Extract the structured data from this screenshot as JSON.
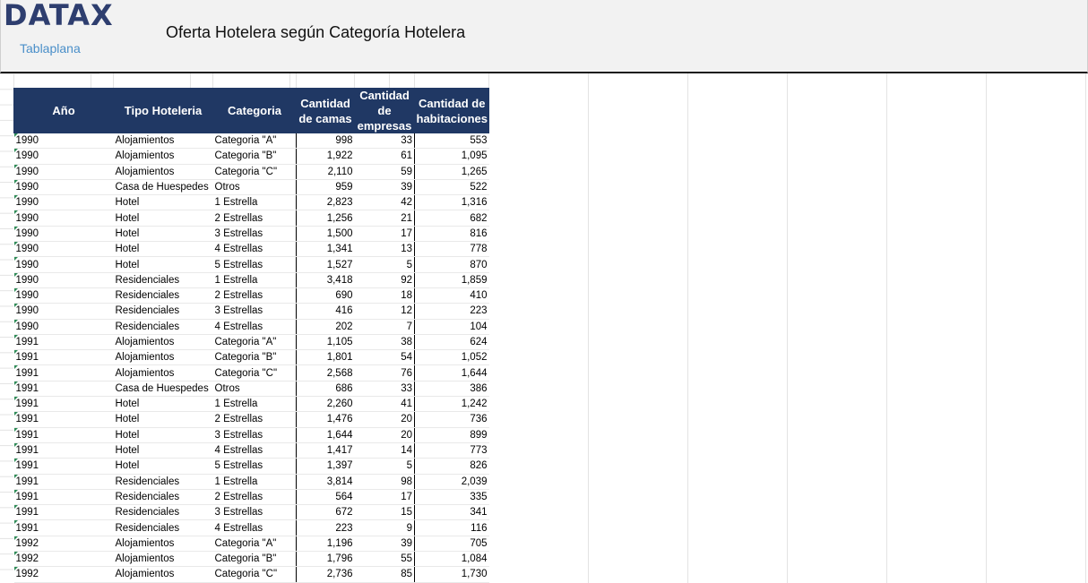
{
  "header": {
    "logo": "DATAX",
    "subtitle": "Tablaplana",
    "title": "Oferta Hotelera según Categoría Hotelera"
  },
  "table": {
    "columns": [
      "Año",
      "Tipo Hoteleria",
      "Categoria",
      "Cantidad de camas",
      "Cantidad de empresas",
      "Cantidad de habitaciones"
    ],
    "rows": [
      [
        "1990",
        "Alojamientos",
        "Categoria \"A\"",
        "998",
        "33",
        "553"
      ],
      [
        "1990",
        "Alojamientos",
        "Categoria \"B\"",
        "1,922",
        "61",
        "1,095"
      ],
      [
        "1990",
        "Alojamientos",
        "Categoria \"C\"",
        "2,110",
        "59",
        "1,265"
      ],
      [
        "1990",
        "Casa de Huespedes",
        "Otros",
        "959",
        "39",
        "522"
      ],
      [
        "1990",
        "Hotel",
        "1 Estrella",
        "2,823",
        "42",
        "1,316"
      ],
      [
        "1990",
        "Hotel",
        "2 Estrellas",
        "1,256",
        "21",
        "682"
      ],
      [
        "1990",
        "Hotel",
        "3 Estrellas",
        "1,500",
        "17",
        "816"
      ],
      [
        "1990",
        "Hotel",
        "4 Estrellas",
        "1,341",
        "13",
        "778"
      ],
      [
        "1990",
        "Hotel",
        "5 Estrellas",
        "1,527",
        "5",
        "870"
      ],
      [
        "1990",
        "Residenciales",
        "1 Estrella",
        "3,418",
        "92",
        "1,859"
      ],
      [
        "1990",
        "Residenciales",
        "2 Estrellas",
        "690",
        "18",
        "410"
      ],
      [
        "1990",
        "Residenciales",
        "3 Estrellas",
        "416",
        "12",
        "223"
      ],
      [
        "1990",
        "Residenciales",
        "4 Estrellas",
        "202",
        "7",
        "104"
      ],
      [
        "1991",
        "Alojamientos",
        "Categoria \"A\"",
        "1,105",
        "38",
        "624"
      ],
      [
        "1991",
        "Alojamientos",
        "Categoria \"B\"",
        "1,801",
        "54",
        "1,052"
      ],
      [
        "1991",
        "Alojamientos",
        "Categoria \"C\"",
        "2,568",
        "76",
        "1,644"
      ],
      [
        "1991",
        "Casa de Huespedes",
        "Otros",
        "686",
        "33",
        "386"
      ],
      [
        "1991",
        "Hotel",
        "1 Estrella",
        "2,260",
        "41",
        "1,242"
      ],
      [
        "1991",
        "Hotel",
        "2 Estrellas",
        "1,476",
        "20",
        "736"
      ],
      [
        "1991",
        "Hotel",
        "3 Estrellas",
        "1,644",
        "20",
        "899"
      ],
      [
        "1991",
        "Hotel",
        "4 Estrellas",
        "1,417",
        "14",
        "773"
      ],
      [
        "1991",
        "Hotel",
        "5 Estrellas",
        "1,397",
        "5",
        "826"
      ],
      [
        "1991",
        "Residenciales",
        "1 Estrella",
        "3,814",
        "98",
        "2,039"
      ],
      [
        "1991",
        "Residenciales",
        "2 Estrellas",
        "564",
        "17",
        "335"
      ],
      [
        "1991",
        "Residenciales",
        "3 Estrellas",
        "672",
        "15",
        "341"
      ],
      [
        "1991",
        "Residenciales",
        "4 Estrellas",
        "223",
        "9",
        "116"
      ],
      [
        "1992",
        "Alojamientos",
        "Categoria \"A\"",
        "1,196",
        "39",
        "705"
      ],
      [
        "1992",
        "Alojamientos",
        "Categoria \"B\"",
        "1,796",
        "55",
        "1,084"
      ],
      [
        "1992",
        "Alojamientos",
        "Categoria \"C\"",
        "2,736",
        "85",
        "1,730"
      ]
    ]
  }
}
